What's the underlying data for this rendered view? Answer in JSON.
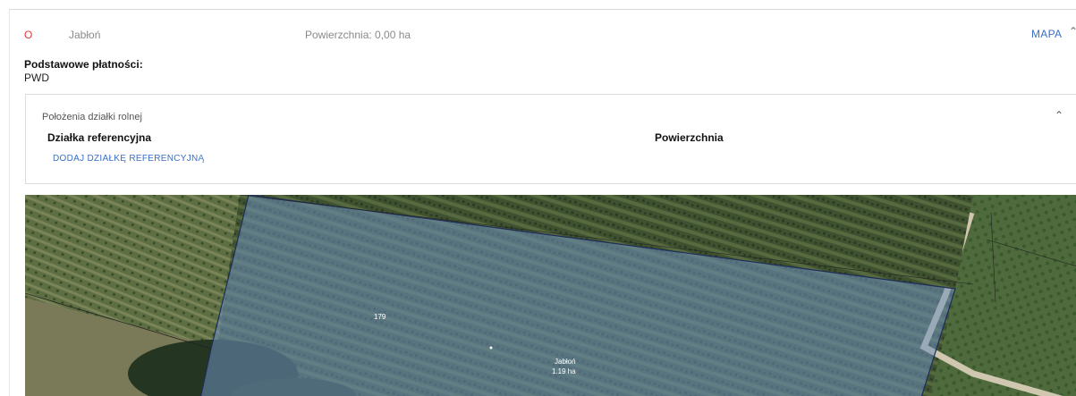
{
  "summary": {
    "code": "O",
    "crop": "Jabłoń",
    "area": "Powierzchnia: 0,00 ha",
    "map_button": "MAPA"
  },
  "payments": {
    "label": "Podstawowe płatności:",
    "value": "PWD"
  },
  "location_panel": {
    "title": "Położenia działki rolnej",
    "columns": [
      "Działka referencyjna",
      "Powierzchnia"
    ],
    "add_button": "DODAJ DZIAŁKĘ REFERENCYJNĄ"
  },
  "map": {
    "parcel_number": "179",
    "parcel_crop": "Jabłoń",
    "parcel_area": "1.19 ha",
    "parcel_fill_color": "#6e8fc0"
  },
  "icons": {
    "collapse_summary": "chevron-up-icon",
    "collapse_panel": "chevron-up-icon"
  }
}
